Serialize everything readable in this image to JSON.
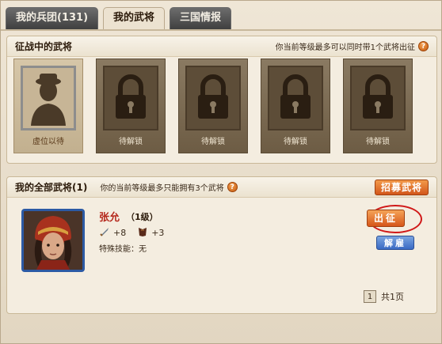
{
  "tabs": [
    {
      "label": "我的兵团(131)",
      "active": false
    },
    {
      "label": "我的武将",
      "active": true
    },
    {
      "label": "三国情报",
      "active": false
    }
  ],
  "campaign": {
    "title": "征战中的武将",
    "note": "你当前等级最多可以同时带1个武将出征",
    "slots": [
      {
        "label": "虚位以待",
        "icon": "empty-general-icon"
      },
      {
        "label": "待解锁",
        "icon": "lock-icon"
      },
      {
        "label": "待解锁",
        "icon": "lock-icon"
      },
      {
        "label": "待解锁",
        "icon": "lock-icon"
      },
      {
        "label": "待解锁",
        "icon": "lock-icon"
      }
    ]
  },
  "all_generals": {
    "title": "我的全部武将(1)",
    "note": "你的当前等级最多只能拥有3个武将",
    "recruit_label": "招募武将",
    "generals": [
      {
        "name": "张允",
        "level": "（1级）",
        "attack": "+8",
        "defense": "+3",
        "skill": "特殊技能：无",
        "deploy_label": "出征",
        "dismiss_label": "解雇"
      }
    ]
  },
  "pagination": {
    "current": "1",
    "total": "共1页"
  },
  "colors": {
    "accent_orange": "#d2561a",
    "name_red": "#b5281c",
    "dismiss_blue": "#3a6ac4",
    "highlight_red": "#d01818"
  }
}
